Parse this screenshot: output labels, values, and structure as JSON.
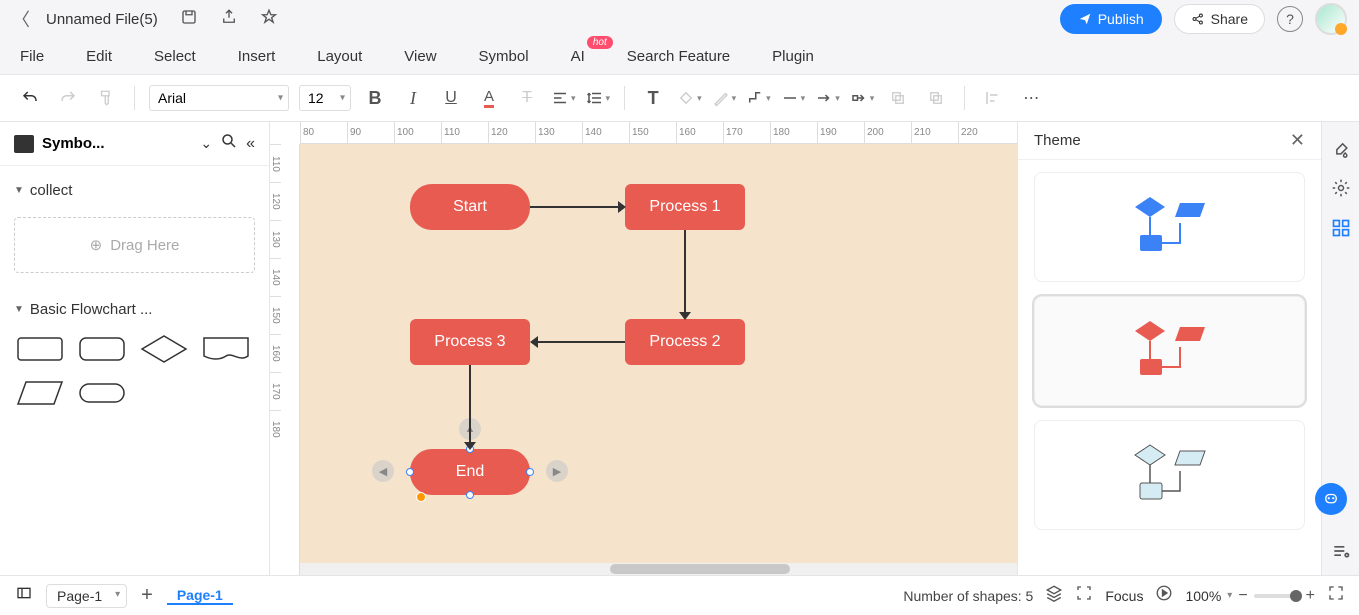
{
  "titlebar": {
    "filename": "Unnamed File(5)",
    "publish_label": "Publish",
    "share_label": "Share"
  },
  "menubar": {
    "items": [
      "File",
      "Edit",
      "Select",
      "Insert",
      "Layout",
      "View",
      "Symbol",
      "AI",
      "Search Feature",
      "Plugin"
    ],
    "hot_badge": "hot"
  },
  "toolbar": {
    "font": "Arial",
    "size": "12"
  },
  "left_panel": {
    "lib_title": "Symbo...",
    "section_collect": "collect",
    "drag_here": "Drag Here",
    "section_basic": "Basic Flowchart ..."
  },
  "ruler_h": [
    "80",
    "90",
    "100",
    "110",
    "120",
    "130",
    "140",
    "150",
    "160",
    "170",
    "180",
    "190",
    "200",
    "210",
    "220"
  ],
  "ruler_v": [
    "110",
    "120",
    "130",
    "140",
    "150",
    "160",
    "170",
    "180"
  ],
  "canvas": {
    "nodes": {
      "start": "Start",
      "process1": "Process 1",
      "process2": "Process 2",
      "process3": "Process 3",
      "end": "End"
    }
  },
  "right_panel": {
    "title": "Theme"
  },
  "bottombar": {
    "page_chip": "Page-1",
    "page_tab": "Page-1",
    "shape_count_label": "Number of shapes: 5",
    "focus_label": "Focus",
    "zoom": "100%"
  }
}
